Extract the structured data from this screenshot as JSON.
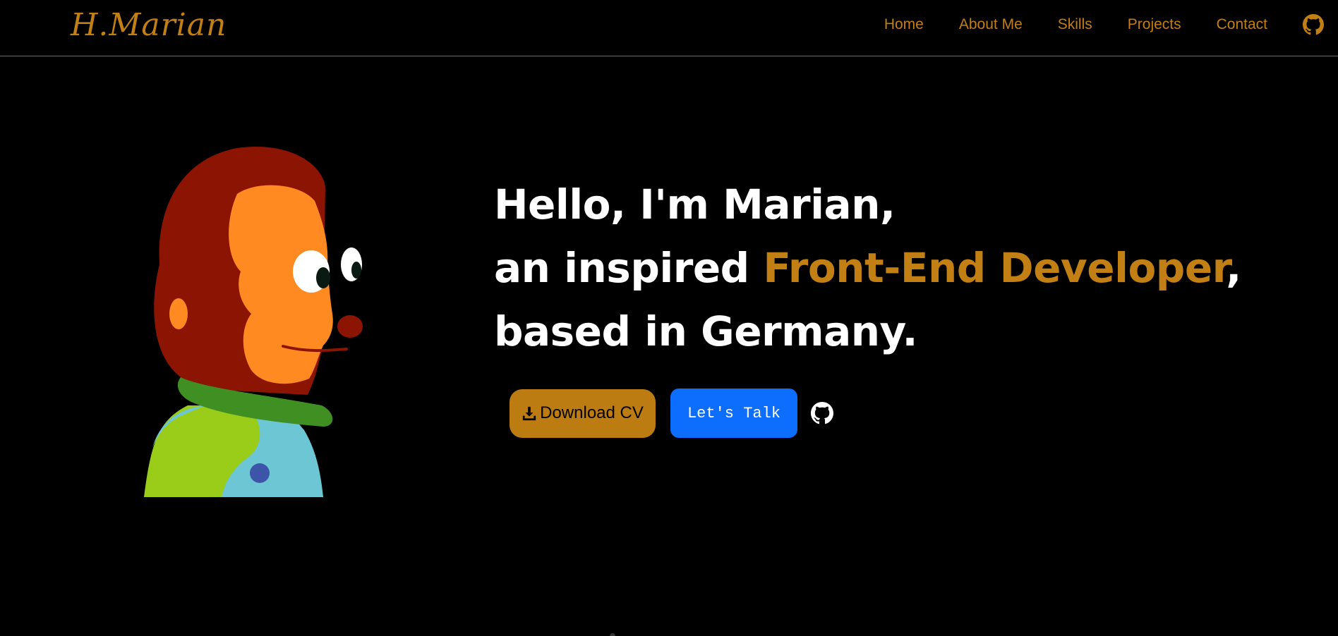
{
  "header": {
    "logo": "H.Marian",
    "nav": [
      "Home",
      "About Me",
      "Skills",
      "Projects",
      "Contact"
    ],
    "github_icon": "github-icon"
  },
  "hero": {
    "line1": "Hello, I'm Marian,",
    "line2_prefix": "an inspired ",
    "line2_accent": "Front-End Developer",
    "line2_suffix": ",",
    "line3": "based in Germany.",
    "download_label": "Download CV",
    "download_icon": "download-icon",
    "talk_label": "Let's Talk",
    "github_icon": "github-icon"
  },
  "colors": {
    "accent": "#c27f14",
    "background": "#000000",
    "primary_button": "#0d6efd"
  }
}
